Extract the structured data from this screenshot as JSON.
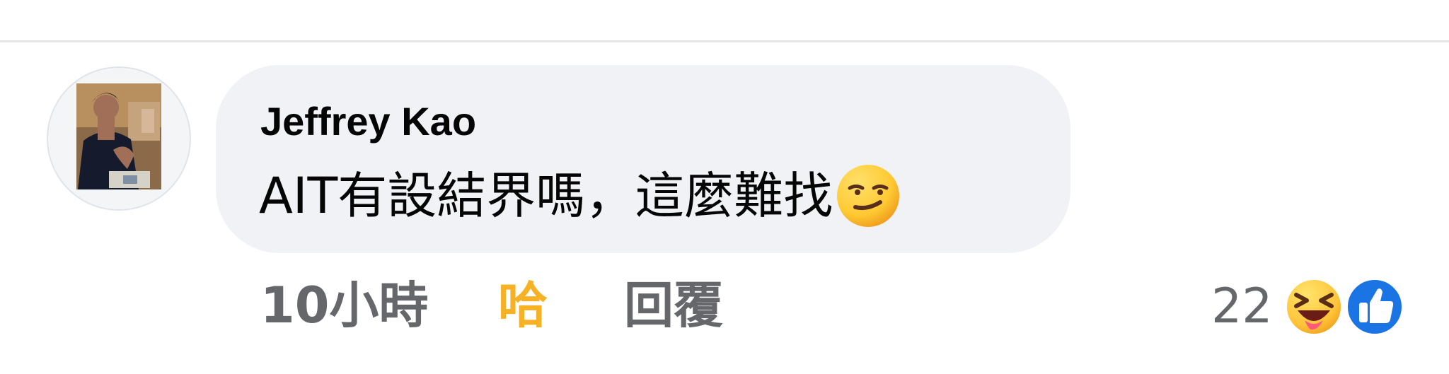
{
  "comment": {
    "author": "Jeffrey Kao",
    "text": "AIT有設結界嗎，這麼難找",
    "inline_emoji": "smirking-face",
    "timestamp": "10小時",
    "reaction_link": "哈",
    "reply_link": "回覆",
    "reaction_count": "22",
    "reaction_types": [
      "haha",
      "like"
    ]
  },
  "colors": {
    "bubble": "#f0f2f5",
    "text": "#050505",
    "secondary_text": "#65676b",
    "haha_accent": "#f7b125",
    "like_blue": "#1b74e4",
    "divider": "#e4e6eb"
  }
}
